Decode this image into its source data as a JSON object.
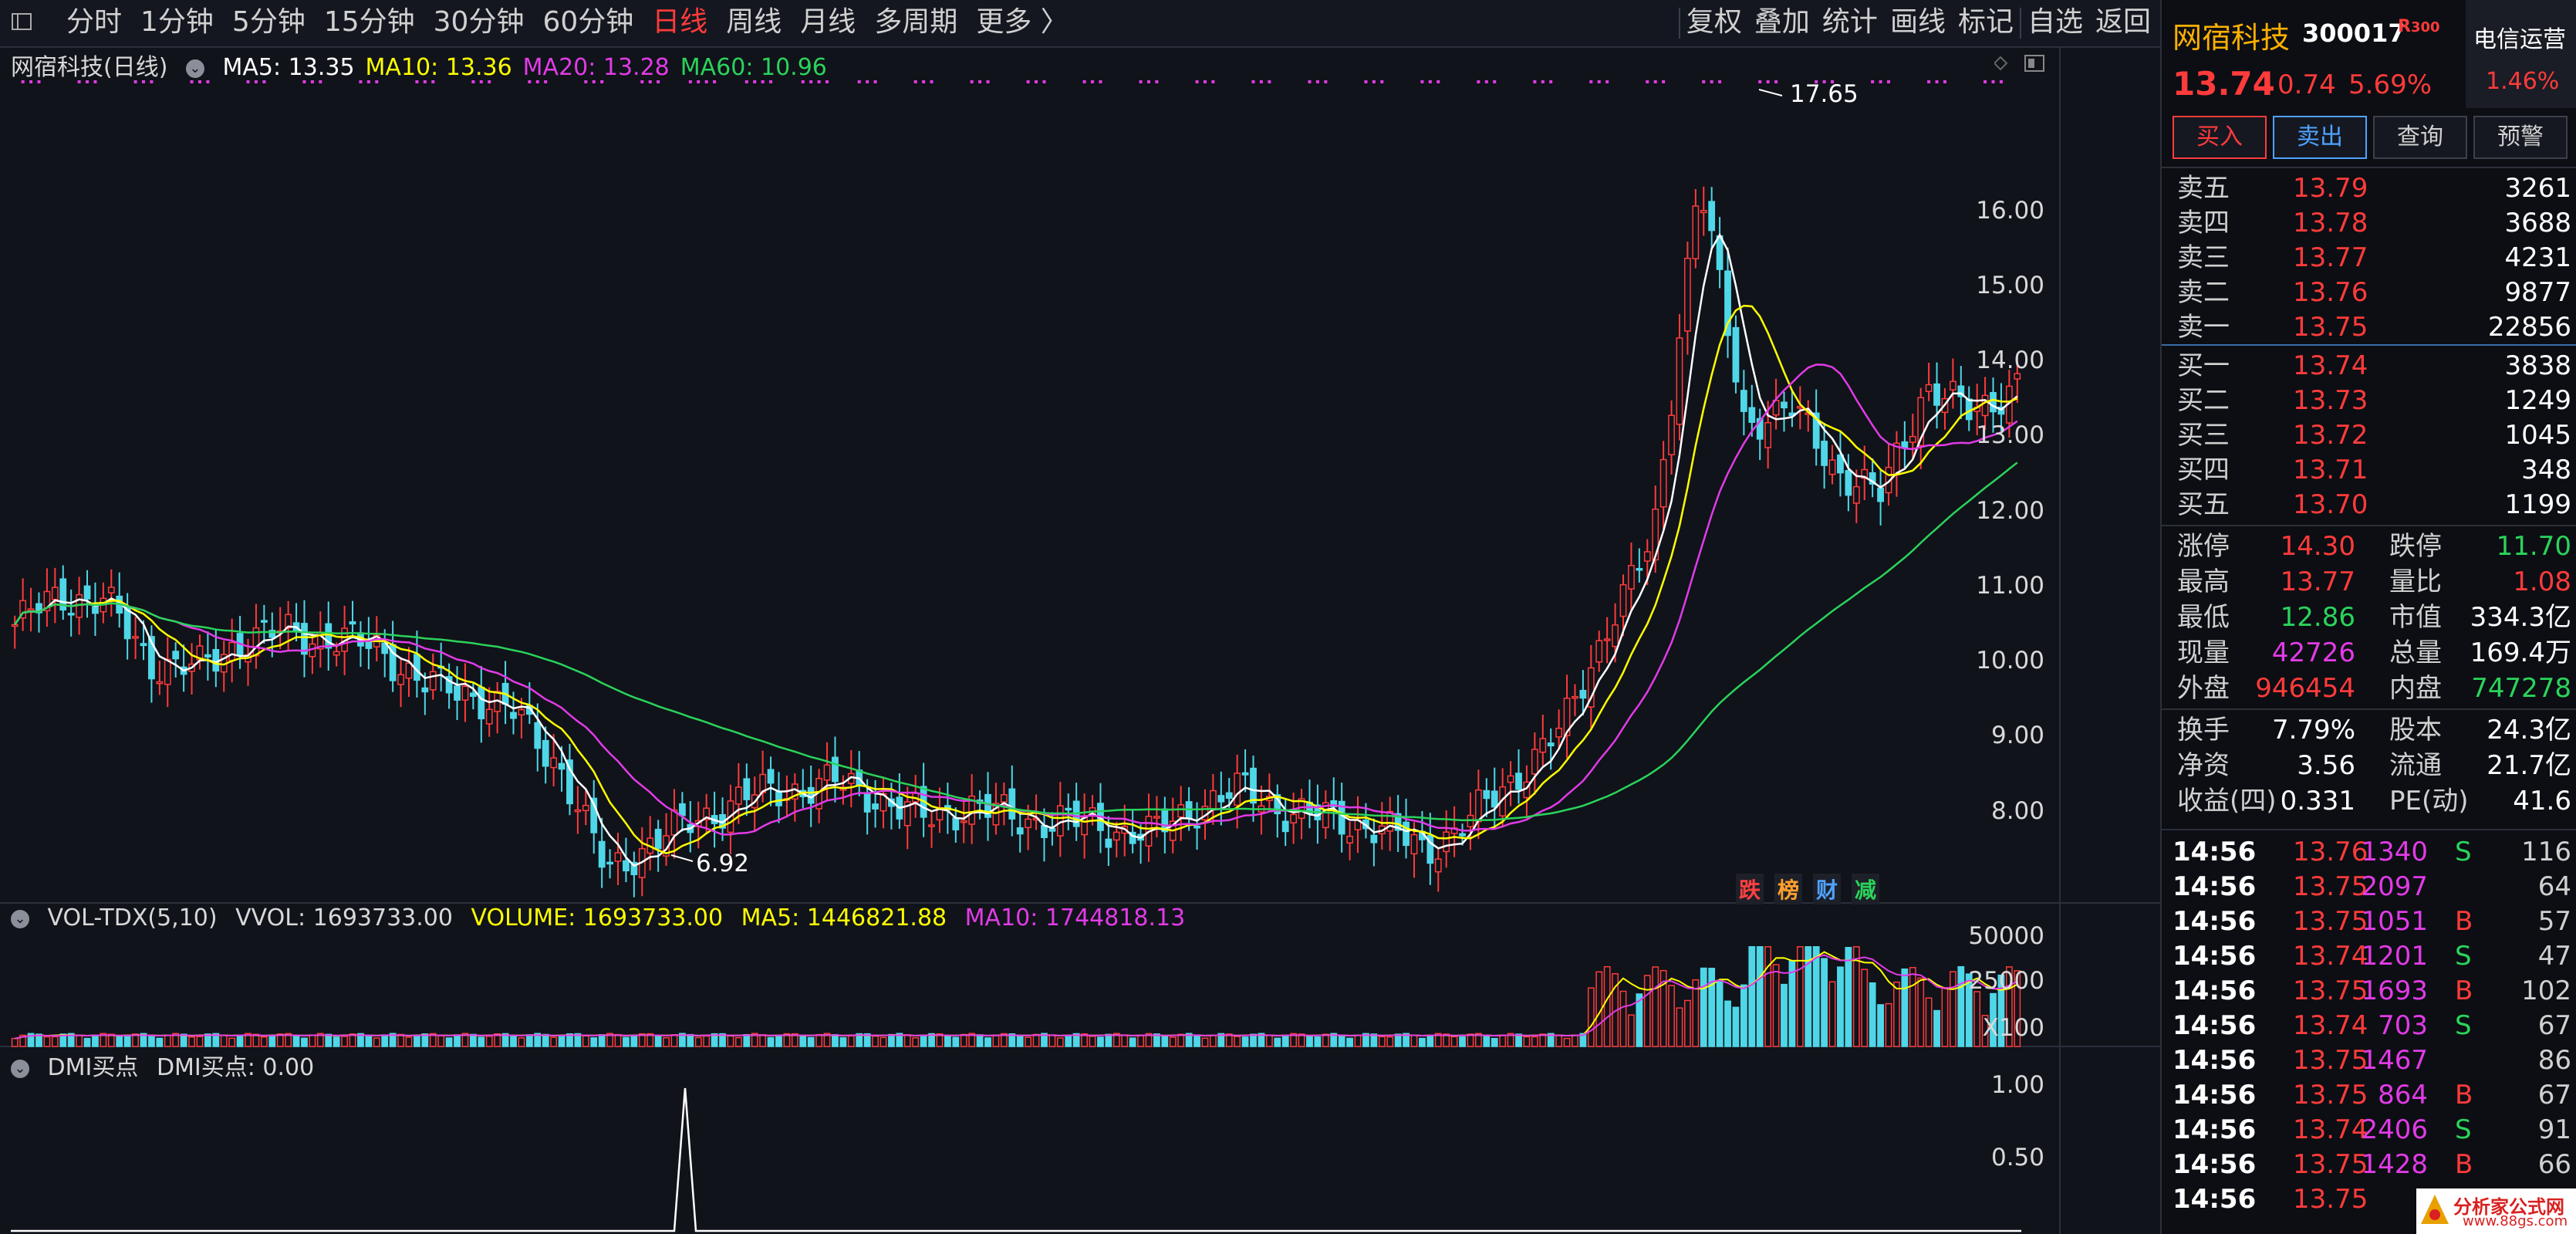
{
  "toolbar": {
    "periods": [
      "分时",
      "1分钟",
      "5分钟",
      "15分钟",
      "30分钟",
      "60分钟",
      "日线",
      "周线",
      "月线",
      "多周期",
      "更多 〉"
    ],
    "active_period": "日线",
    "tools": [
      "复权",
      "叠加",
      "统计",
      "画线",
      "标记",
      "自选",
      "返回"
    ]
  },
  "main_chart": {
    "title": "网宿科技(日线)",
    "ma_labels": [
      {
        "text": "MA5: 13.35",
        "color": "#ffffff"
      },
      {
        "text": "MA10: 13.36",
        "color": "#ffff00"
      },
      {
        "text": "MA20: 13.28",
        "color": "#e13be6"
      },
      {
        "text": "MA60: 10.96",
        "color": "#2bd35b"
      }
    ],
    "high_anno": "17.65",
    "low_anno": "6.92",
    "badges": [
      {
        "text": "跌",
        "color": "#ff4040"
      },
      {
        "text": "榜",
        "color": "#ff9f2e"
      },
      {
        "text": "财",
        "color": "#4fa3ff"
      },
      {
        "text": "减",
        "color": "#2bd35b"
      }
    ]
  },
  "volume_chart": {
    "title": "VOL-TDX(5,10)",
    "vvol": "VVOL: 1693733.00",
    "volume": "VOLUME: 1693733.00",
    "ma5": "MA5: 1446821.88",
    "ma10": "MA10: 1744818.13",
    "unit": "X100"
  },
  "dmi_chart": {
    "title": "DMI买点",
    "value": "DMI买点: 0.00"
  },
  "chart_data": [
    {
      "type": "candlestick",
      "title": "网宿科技(日线)",
      "y_ticks": [
        "16.00",
        "15.00",
        "14.00",
        "13.00",
        "12.00",
        "11.00",
        "10.00",
        "9.00",
        "8.00"
      ],
      "ylim": [
        7.1,
        17.9
      ],
      "high": 17.65,
      "low": 6.92,
      "close_samples": [
        10.5,
        10.9,
        10.8,
        10.0,
        9.9,
        10.3,
        10.4,
        10.3,
        10.2,
        9.7,
        9.6,
        9.3,
        8.6,
        7.2,
        7.6,
        7.9,
        8.2,
        8.3,
        8.4,
        8.2,
        7.9,
        8.1,
        7.9,
        7.9,
        7.8,
        7.7,
        8.1,
        8.3,
        8.0,
        7.9,
        7.8,
        7.5,
        7.9,
        8.5,
        9.1,
        10.5,
        11.6,
        16.5,
        13.2,
        13.4,
        12.6,
        12.2,
        13.7,
        13.3,
        13.74
      ]
    },
    {
      "type": "bar",
      "title": "VOL-TDX(5,10)",
      "y_ticks": [
        "50000",
        "25000"
      ],
      "unit": "X100"
    },
    {
      "type": "line",
      "title": "DMI买点",
      "y_ticks": [
        "1.00",
        "0.50"
      ],
      "peak_value": 1.0
    }
  ],
  "quote": {
    "name": "网宿科技",
    "code": "300017",
    "tag": "R",
    "tag2": "300",
    "price": "13.74",
    "change": "0.74",
    "change_pct": "5.69%",
    "peer_name": "电信运营",
    "peer_pct": "1.46%",
    "buttons": [
      "买入",
      "卖出",
      "查询",
      "预警"
    ],
    "asks": [
      {
        "label": "卖五",
        "price": "13.79",
        "vol": "3261"
      },
      {
        "label": "卖四",
        "price": "13.78",
        "vol": "3688"
      },
      {
        "label": "卖三",
        "price": "13.77",
        "vol": "4231"
      },
      {
        "label": "卖二",
        "price": "13.76",
        "vol": "9877"
      },
      {
        "label": "卖一",
        "price": "13.75",
        "vol": "22856"
      }
    ],
    "bids": [
      {
        "label": "买一",
        "price": "13.74",
        "vol": "3838"
      },
      {
        "label": "买二",
        "price": "13.73",
        "vol": "1249"
      },
      {
        "label": "买三",
        "price": "13.72",
        "vol": "1045"
      },
      {
        "label": "买四",
        "price": "13.71",
        "vol": "348"
      },
      {
        "label": "买五",
        "price": "13.70",
        "vol": "1199"
      }
    ],
    "stats": [
      {
        "l1": "涨停",
        "v1": "14.30",
        "c1": "red",
        "l2": "跌停",
        "v2": "11.70",
        "c2": "green"
      },
      {
        "l1": "最高",
        "v1": "13.77",
        "c1": "red",
        "l2": "量比",
        "v2": "1.08",
        "c2": "red"
      },
      {
        "l1": "最低",
        "v1": "12.86",
        "c1": "green",
        "l2": "市值",
        "v2": "334.3亿",
        "c2": "white"
      },
      {
        "l1": "现量",
        "v1": "42726",
        "c1": "magenta",
        "l2": "总量",
        "v2": "169.4万",
        "c2": "white"
      },
      {
        "l1": "外盘",
        "v1": "946454",
        "c1": "red",
        "l2": "内盘",
        "v2": "747278",
        "c2": "green"
      }
    ],
    "fundamentals": [
      {
        "l1": "换手",
        "v1": "7.79%",
        "l2": "股本",
        "v2": "24.3亿"
      },
      {
        "l1": "净资",
        "v1": "3.56",
        "l2": "流通",
        "v2": "21.7亿"
      },
      {
        "l1": "收益(四)",
        "v1": "0.331",
        "l2": "PE(动)",
        "v2": "41.6"
      }
    ],
    "ticks": [
      {
        "time": "14:56",
        "price": "13.76",
        "vol": "1340",
        "side": "S",
        "n": "116"
      },
      {
        "time": "14:56",
        "price": "13.75",
        "vol": "2097",
        "side": "",
        "n": "64"
      },
      {
        "time": "14:56",
        "price": "13.75",
        "vol": "1051",
        "side": "B",
        "n": "57"
      },
      {
        "time": "14:56",
        "price": "13.74",
        "vol": "1201",
        "side": "S",
        "n": "47"
      },
      {
        "time": "14:56",
        "price": "13.75",
        "vol": "1693",
        "side": "B",
        "n": "102"
      },
      {
        "time": "14:56",
        "price": "13.74",
        "vol": "703",
        "side": "S",
        "n": "67"
      },
      {
        "time": "14:56",
        "price": "13.75",
        "vol": "1467",
        "side": "",
        "n": "86"
      },
      {
        "time": "14:56",
        "price": "13.75",
        "vol": "864",
        "side": "B",
        "n": "67"
      },
      {
        "time": "14:56",
        "price": "13.74",
        "vol": "2406",
        "side": "S",
        "n": "91"
      },
      {
        "time": "14:56",
        "price": "13.75",
        "vol": "1428",
        "side": "B",
        "n": "66"
      },
      {
        "time": "14:56",
        "price": "13.75",
        "vol": "",
        "side": "",
        "n": ""
      }
    ],
    "watermark": "分析家公式网",
    "watermark_url": "www.88gs.com"
  }
}
